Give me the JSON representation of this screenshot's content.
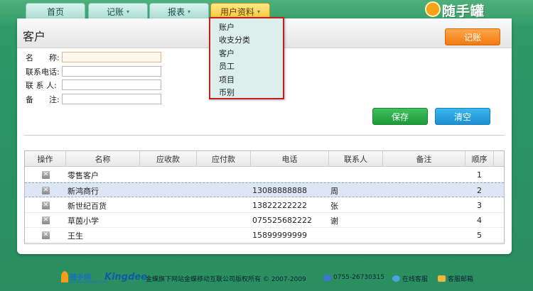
{
  "nav": {
    "tabs": [
      {
        "label": "首页",
        "caret": ""
      },
      {
        "label": "记账",
        "caret": "▾"
      },
      {
        "label": "报表",
        "caret": "▾"
      },
      {
        "label": "用户资料",
        "caret": "▾"
      }
    ],
    "brand": "随手罐"
  },
  "dropdown": {
    "items": [
      "账户",
      "收支分类",
      "客户",
      "员工",
      "项目",
      "币别"
    ]
  },
  "page": {
    "title": "客户",
    "jizhang_button": "记账"
  },
  "form": {
    "name_label": "名　　称:",
    "phone_label": "联系电话:",
    "contact_label": "联 系 人:",
    "note_label": "备　　注:",
    "save_button": "保存",
    "clear_button": "清空"
  },
  "grid": {
    "columns": [
      "操作",
      "名称",
      "应收款",
      "应付款",
      "电话",
      "联系人",
      "备注",
      "顺序"
    ],
    "rows": [
      {
        "name": "零售客户",
        "phone": "",
        "contact": "",
        "order": "1"
      },
      {
        "name": "新鸿商行",
        "phone": "13088888888",
        "contact": "周",
        "order": "2"
      },
      {
        "name": "新世纪百货",
        "phone": "13822222222",
        "contact": "张",
        "order": "3"
      },
      {
        "name": "草茵小学",
        "phone": "075525682222",
        "contact": "谢",
        "order": "4"
      },
      {
        "name": "王生",
        "phone": "15899999999",
        "contact": "",
        "order": "5"
      }
    ]
  },
  "footer": {
    "logo_name": "随手网",
    "logo_sub": "suishouwang.com",
    "kingdee": "Kingdee",
    "copyright": "金蝶旗下网站金蝶移动互联公司版权所有 © 2007-2009",
    "phone": "0755-26730315",
    "online_service": "在线客服",
    "email_service": "客服邮箱"
  }
}
